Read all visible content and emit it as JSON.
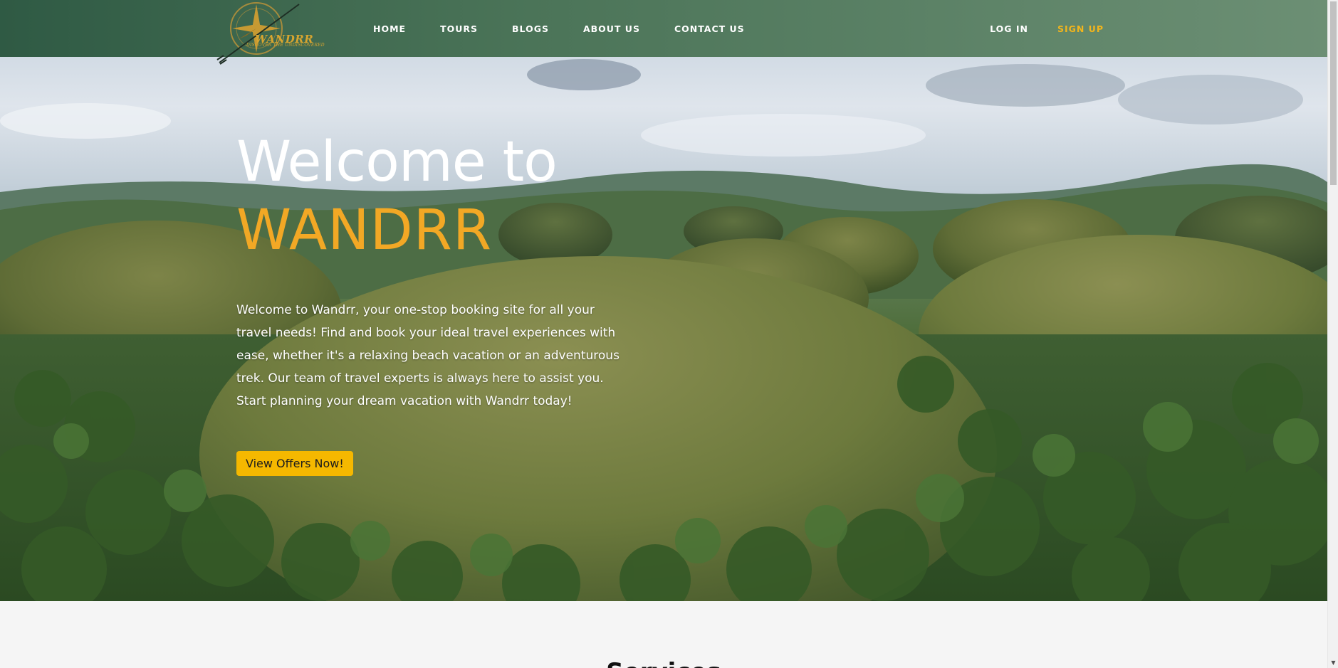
{
  "brand": {
    "name": "WANDRR",
    "tagline": "DISCOVER THE UNDISCOVERED",
    "accent_color": "#f2a825",
    "nav_color": "#4b7458"
  },
  "nav": {
    "links": [
      "HOME",
      "TOURS",
      "BLOGS",
      "ABOUT US",
      "CONTACT US"
    ],
    "login": "LOG IN",
    "signup": "SIGN UP"
  },
  "hero": {
    "title_line1": "Welcome to",
    "title_line2": "WANDRR",
    "description": "Welcome to Wandrr, your one-stop booking site for all your travel needs! Find and book your ideal travel experiences with ease, whether it's a relaxing beach vacation or an adventurous trek. Our team of travel experts is always here to assist you. Start planning your dream vacation with Wandrr today!",
    "cta_label": "View Offers Now!",
    "cta_color": "#f5b800",
    "background_image": "chocolate-hills-landscape"
  },
  "services": {
    "title": "Services"
  },
  "icons": {
    "logo": "compass-logo-icon",
    "scroll_down": "chevron-down-icon"
  }
}
